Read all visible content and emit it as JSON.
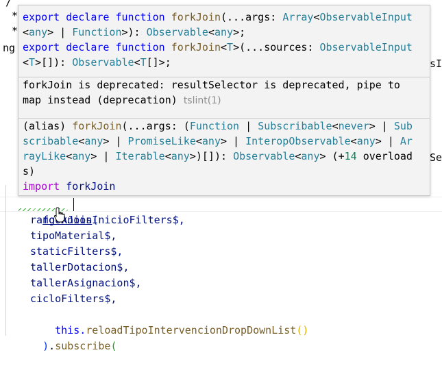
{
  "background": {
    "left_fragments": [
      {
        "text": "/"
      },
      {
        "text": "*"
      },
      {
        "text": "*"
      },
      {
        "text": "ng"
      }
    ],
    "right_fragments": [
      {
        "text": "sI"
      },
      {
        "text": "Se"
      }
    ]
  },
  "hover": {
    "signature_lines": [
      [
        {
          "t": "export",
          "c": "kw"
        },
        {
          "t": " ",
          "c": "pl"
        },
        {
          "t": "declare",
          "c": "kw"
        },
        {
          "t": " ",
          "c": "pl"
        },
        {
          "t": "function",
          "c": "kw"
        },
        {
          "t": " ",
          "c": "pl"
        },
        {
          "t": "forkJoin",
          "c": "fn"
        },
        {
          "t": "(...args: ",
          "c": "pl"
        },
        {
          "t": "Array",
          "c": "ty"
        },
        {
          "t": "<",
          "c": "pl"
        },
        {
          "t": "ObservableInput",
          "c": "ty"
        }
      ],
      [
        {
          "t": "<",
          "c": "pl"
        },
        {
          "t": "any",
          "c": "ty"
        },
        {
          "t": "> | ",
          "c": "pl"
        },
        {
          "t": "Function",
          "c": "ty"
        },
        {
          "t": ">): ",
          "c": "pl"
        },
        {
          "t": "Observable",
          "c": "ty"
        },
        {
          "t": "<",
          "c": "pl"
        },
        {
          "t": "any",
          "c": "ty"
        },
        {
          "t": ">;",
          "c": "pl"
        }
      ],
      [
        {
          "t": "export",
          "c": "kw"
        },
        {
          "t": " ",
          "c": "pl"
        },
        {
          "t": "declare",
          "c": "kw"
        },
        {
          "t": " ",
          "c": "pl"
        },
        {
          "t": "function",
          "c": "kw"
        },
        {
          "t": " ",
          "c": "pl"
        },
        {
          "t": "forkJoin",
          "c": "fn"
        },
        {
          "t": "<",
          "c": "pl"
        },
        {
          "t": "T",
          "c": "ty"
        },
        {
          "t": ">(...sources: ",
          "c": "pl"
        },
        {
          "t": "ObservableInput",
          "c": "ty"
        }
      ],
      [
        {
          "t": "<",
          "c": "pl"
        },
        {
          "t": "T",
          "c": "ty"
        },
        {
          "t": ">[]): ",
          "c": "pl"
        },
        {
          "t": "Observable",
          "c": "ty"
        },
        {
          "t": "<",
          "c": "pl"
        },
        {
          "t": "T",
          "c": "ty"
        },
        {
          "t": "[]>;",
          "c": "pl"
        }
      ]
    ],
    "deprecation_lines": [
      [
        {
          "t": "forkJoin is deprecated: resultSelector is deprecated, pipe to",
          "c": "pl"
        }
      ],
      [
        {
          "t": "map instead (deprecation) ",
          "c": "pl"
        },
        {
          "t": "tslint(1)",
          "c": "gr"
        }
      ]
    ],
    "alias_lines": [
      [
        {
          "t": "(alias) ",
          "c": "pl"
        },
        {
          "t": "forkJoin",
          "c": "fn"
        },
        {
          "t": "(...args: (",
          "c": "pl"
        },
        {
          "t": "Function",
          "c": "ty"
        },
        {
          "t": " | ",
          "c": "pl"
        },
        {
          "t": "Subscribable",
          "c": "ty"
        },
        {
          "t": "<",
          "c": "pl"
        },
        {
          "t": "never",
          "c": "ty"
        },
        {
          "t": "> | ",
          "c": "pl"
        },
        {
          "t": "Sub",
          "c": "ty"
        }
      ],
      [
        {
          "t": "scribable",
          "c": "ty"
        },
        {
          "t": "<",
          "c": "pl"
        },
        {
          "t": "any",
          "c": "ty"
        },
        {
          "t": "> | ",
          "c": "pl"
        },
        {
          "t": "PromiseLike",
          "c": "ty"
        },
        {
          "t": "<",
          "c": "pl"
        },
        {
          "t": "any",
          "c": "ty"
        },
        {
          "t": "> | ",
          "c": "pl"
        },
        {
          "t": "InteropObservable",
          "c": "ty"
        },
        {
          "t": "<",
          "c": "pl"
        },
        {
          "t": "any",
          "c": "ty"
        },
        {
          "t": "> | ",
          "c": "pl"
        },
        {
          "t": "Ar",
          "c": "ty"
        }
      ],
      [
        {
          "t": "rayLike",
          "c": "ty"
        },
        {
          "t": "<",
          "c": "pl"
        },
        {
          "t": "any",
          "c": "ty"
        },
        {
          "t": "> | ",
          "c": "pl"
        },
        {
          "t": "Iterable",
          "c": "ty"
        },
        {
          "t": "<",
          "c": "pl"
        },
        {
          "t": "any",
          "c": "ty"
        },
        {
          "t": ">)[]): ",
          "c": "pl"
        },
        {
          "t": "Observable",
          "c": "ty"
        },
        {
          "t": "<",
          "c": "pl"
        },
        {
          "t": "any",
          "c": "ty"
        },
        {
          "t": "> (+",
          "c": "pl"
        },
        {
          "t": "14",
          "c": "nu"
        },
        {
          "t": " overload",
          "c": "pl"
        }
      ],
      [
        {
          "t": "s)",
          "c": "pl"
        }
      ],
      [
        {
          "t": "import",
          "c": "im"
        },
        {
          "t": " ",
          "c": "pl"
        },
        {
          "t": "forkJoin",
          "c": "id"
        }
      ]
    ]
  },
  "code": {
    "call_name": "forkJoin",
    "open_paren": "(",
    "args": [
      "rangoAniosInicioFilters$,",
      "tipoMaterial$,",
      "staticFilters$,",
      "tallerDotacion$,",
      "tallerAsignacion$,",
      "cicloFilters$,"
    ],
    "last_arg": {
      "prefix": "this.",
      "method": "reloadTipoIntervencionDropDownList",
      "parens": "()"
    },
    "closing": {
      "paren": ")",
      "dot": ".",
      "method": "subscribe",
      "open_paren": "("
    }
  },
  "colors": {
    "keyword": "#0000ff",
    "function": "#795e26",
    "type": "#267f99",
    "number": "#098658",
    "import": "#af00db",
    "identifier": "#001080",
    "bracket": "#0431fa",
    "squiggle": "#2bb02b"
  },
  "icons": {
    "cursor": "hand-pointer"
  }
}
